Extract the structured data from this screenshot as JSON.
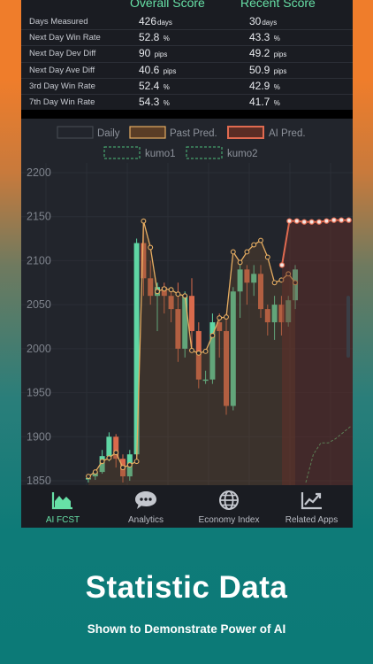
{
  "stats": {
    "headers": {
      "overall": "Overall Score",
      "recent": "Recent Score"
    },
    "rows": [
      {
        "label": "Days Measured",
        "overall": "426",
        "overall_unit": "days",
        "recent": "30",
        "recent_unit": "days"
      },
      {
        "label": "Next Day Win Rate",
        "overall": "52.8",
        "overall_unit": "%",
        "recent": "43.3",
        "recent_unit": "%"
      },
      {
        "label": "Next Day Dev Diff",
        "overall": "90",
        "overall_unit": "pips",
        "recent": "49.2",
        "recent_unit": "pips"
      },
      {
        "label": "Next Day Ave Diff",
        "overall": "40.6",
        "overall_unit": "pips",
        "recent": "50.9",
        "recent_unit": "pips"
      },
      {
        "label": "3rd Day Win Rate",
        "overall": "52.4",
        "overall_unit": "%",
        "recent": "42.9",
        "recent_unit": "%"
      },
      {
        "label": "7th Day Win Rate",
        "overall": "54.3",
        "overall_unit": "%",
        "recent": "41.7",
        "recent_unit": "%"
      }
    ]
  },
  "chart_data": {
    "type": "candlestick",
    "legend": [
      "Daily",
      "Past Pred.",
      "AI Pred.",
      "kumo1",
      "kumo2"
    ],
    "y_ticks": [
      "2200",
      "2150",
      "2100",
      "2050",
      "2000",
      "1950",
      "1900",
      "1850"
    ],
    "ylim": [
      1845,
      2205
    ],
    "colors": {
      "up": "#5fd6a4",
      "down": "#d96a4c",
      "past_pred": "#e6ad62",
      "ai_pred": "#e06a50",
      "kumo": "#4fc07b"
    },
    "candles": [
      [
        1853,
        1853,
        1848,
        1855
      ],
      [
        1855,
        1860,
        1851,
        1862
      ],
      [
        1860,
        1878,
        1858,
        1885
      ],
      [
        1878,
        1900,
        1872,
        1905
      ],
      [
        1900,
        1875,
        1865,
        1903
      ],
      [
        1875,
        1855,
        1848,
        1880
      ],
      [
        1855,
        1880,
        1850,
        1885
      ],
      [
        1880,
        2120,
        1878,
        2125
      ],
      [
        2120,
        2080,
        2060,
        2145
      ],
      [
        2080,
        2060,
        2050,
        2100
      ],
      [
        2060,
        2070,
        2020,
        2075
      ],
      [
        2070,
        2060,
        2040,
        2075
      ],
      [
        2060,
        2045,
        2030,
        2065
      ],
      [
        2045,
        2000,
        1985,
        2075
      ],
      [
        2000,
        2060,
        1990,
        2065
      ],
      [
        2060,
        2020,
        1995,
        2080
      ],
      [
        2020,
        1965,
        1955,
        2030
      ],
      [
        1965,
        1965,
        1960,
        1975
      ],
      [
        1965,
        2030,
        1960,
        2040
      ],
      [
        2030,
        2020,
        1990,
        2040
      ],
      [
        2020,
        1935,
        1925,
        2040
      ],
      [
        1935,
        2065,
        1930,
        2070
      ],
      [
        2065,
        2090,
        2035,
        2100
      ],
      [
        2090,
        2075,
        2050,
        2095
      ],
      [
        2075,
        2085,
        2060,
        2095
      ],
      [
        2085,
        2045,
        2035,
        2095
      ],
      [
        2045,
        2030,
        2015,
        2050
      ],
      [
        2030,
        2050,
        2010,
        2060
      ],
      [
        2050,
        2030,
        2015,
        2060
      ],
      [
        2030,
        2055,
        2025,
        2060
      ],
      [
        2055,
        2090,
        2045,
        2095
      ]
    ],
    "past_pred": [
      1855,
      1860,
      1872,
      1876,
      1882,
      1865,
      1868,
      1872,
      2145,
      2115,
      2065,
      2068,
      2067,
      2062,
      2060,
      1998,
      1995,
      1997,
      2015,
      2035,
      2036,
      2110,
      2098,
      2110,
      2118,
      2123,
      2104,
      2075,
      2078,
      2085,
      2075
    ],
    "ai_pred": [
      2095,
      2145,
      2145,
      2144,
      2144,
      2144,
      2145,
      2146,
      2146,
      2146
    ],
    "kumo_start": 2095,
    "kumo": [
      1848,
      1880,
      1893,
      1893,
      1898,
      1905,
      1912
    ]
  },
  "tabs": [
    {
      "label": "AI FCST",
      "icon": "area-chart-icon",
      "active": true
    },
    {
      "label": "Analytics",
      "icon": "speech-bubble-icon",
      "active": false
    },
    {
      "label": "Economy Index",
      "icon": "globe-icon",
      "active": false
    },
    {
      "label": "Related Apps",
      "icon": "trend-chart-icon",
      "active": false
    }
  ],
  "promo": {
    "title": "Statistic Data",
    "subtitle": "Shown to Demonstrate Power of AI"
  }
}
